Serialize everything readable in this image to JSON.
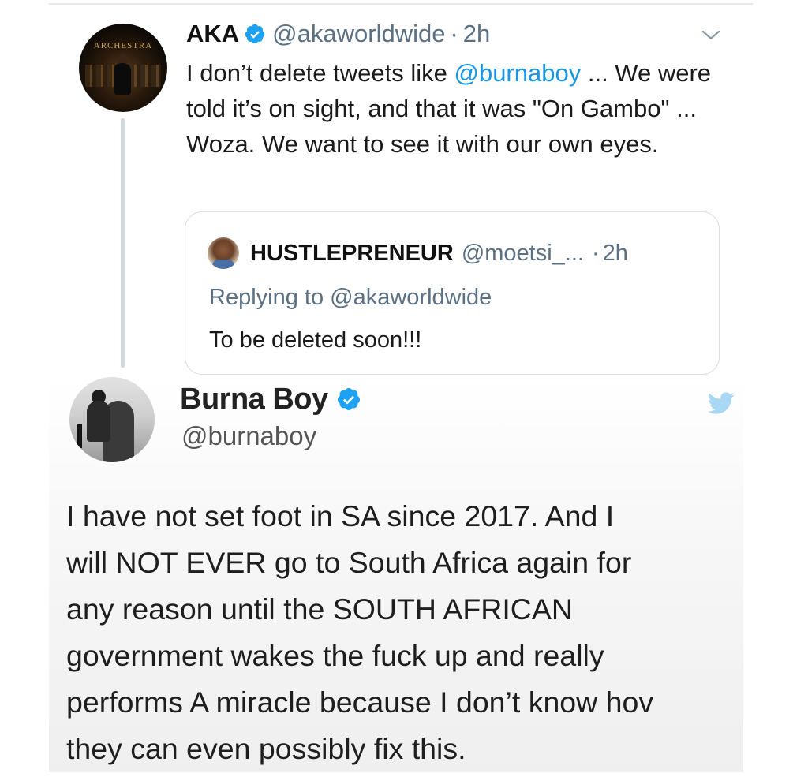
{
  "colors": {
    "link": "#1b95e0",
    "secondary_text": "#5b7083",
    "verified_badge": "#1da1f2",
    "thread_line": "#cfd9de"
  },
  "aka_tweet": {
    "avatar_logo_text": "ARCHESTRA",
    "display_name": "AKA",
    "handle": "@akaworldwide",
    "separator": "·",
    "time": "2h",
    "text_part1": "I don’t delete tweets like ",
    "mention": "@burnaboy",
    "text_part2": " ... We were told it’s on sight, and that it was \"On Gambo\" ... Woza. We want to see it with our own eyes.",
    "icons": {
      "verified": "verified-badge-icon",
      "menu": "chevron-down-icon"
    }
  },
  "quoted_tweet": {
    "display_name": "HUSTLEPRENEUR",
    "handle": "@moetsi_...",
    "separator": "·",
    "time": "2h",
    "replying_label": "Replying to ",
    "replying_to": "@akaworldwide",
    "text": "To be deleted soon!!!"
  },
  "burna_tweet": {
    "display_name": "Burna Boy",
    "handle": "@burnaboy",
    "text": "I have not set foot in SA since 2017. And I\nwill NOT EVER go to South Africa again for\nany reason until the SOUTH AFRICAN\ngovernment wakes the fuck up and really\nperforms A miracle because I don’t know hov\nthey can even possibly fix this.",
    "icons": {
      "verified": "verified-badge-icon",
      "logo": "twitter-bird-icon"
    }
  }
}
